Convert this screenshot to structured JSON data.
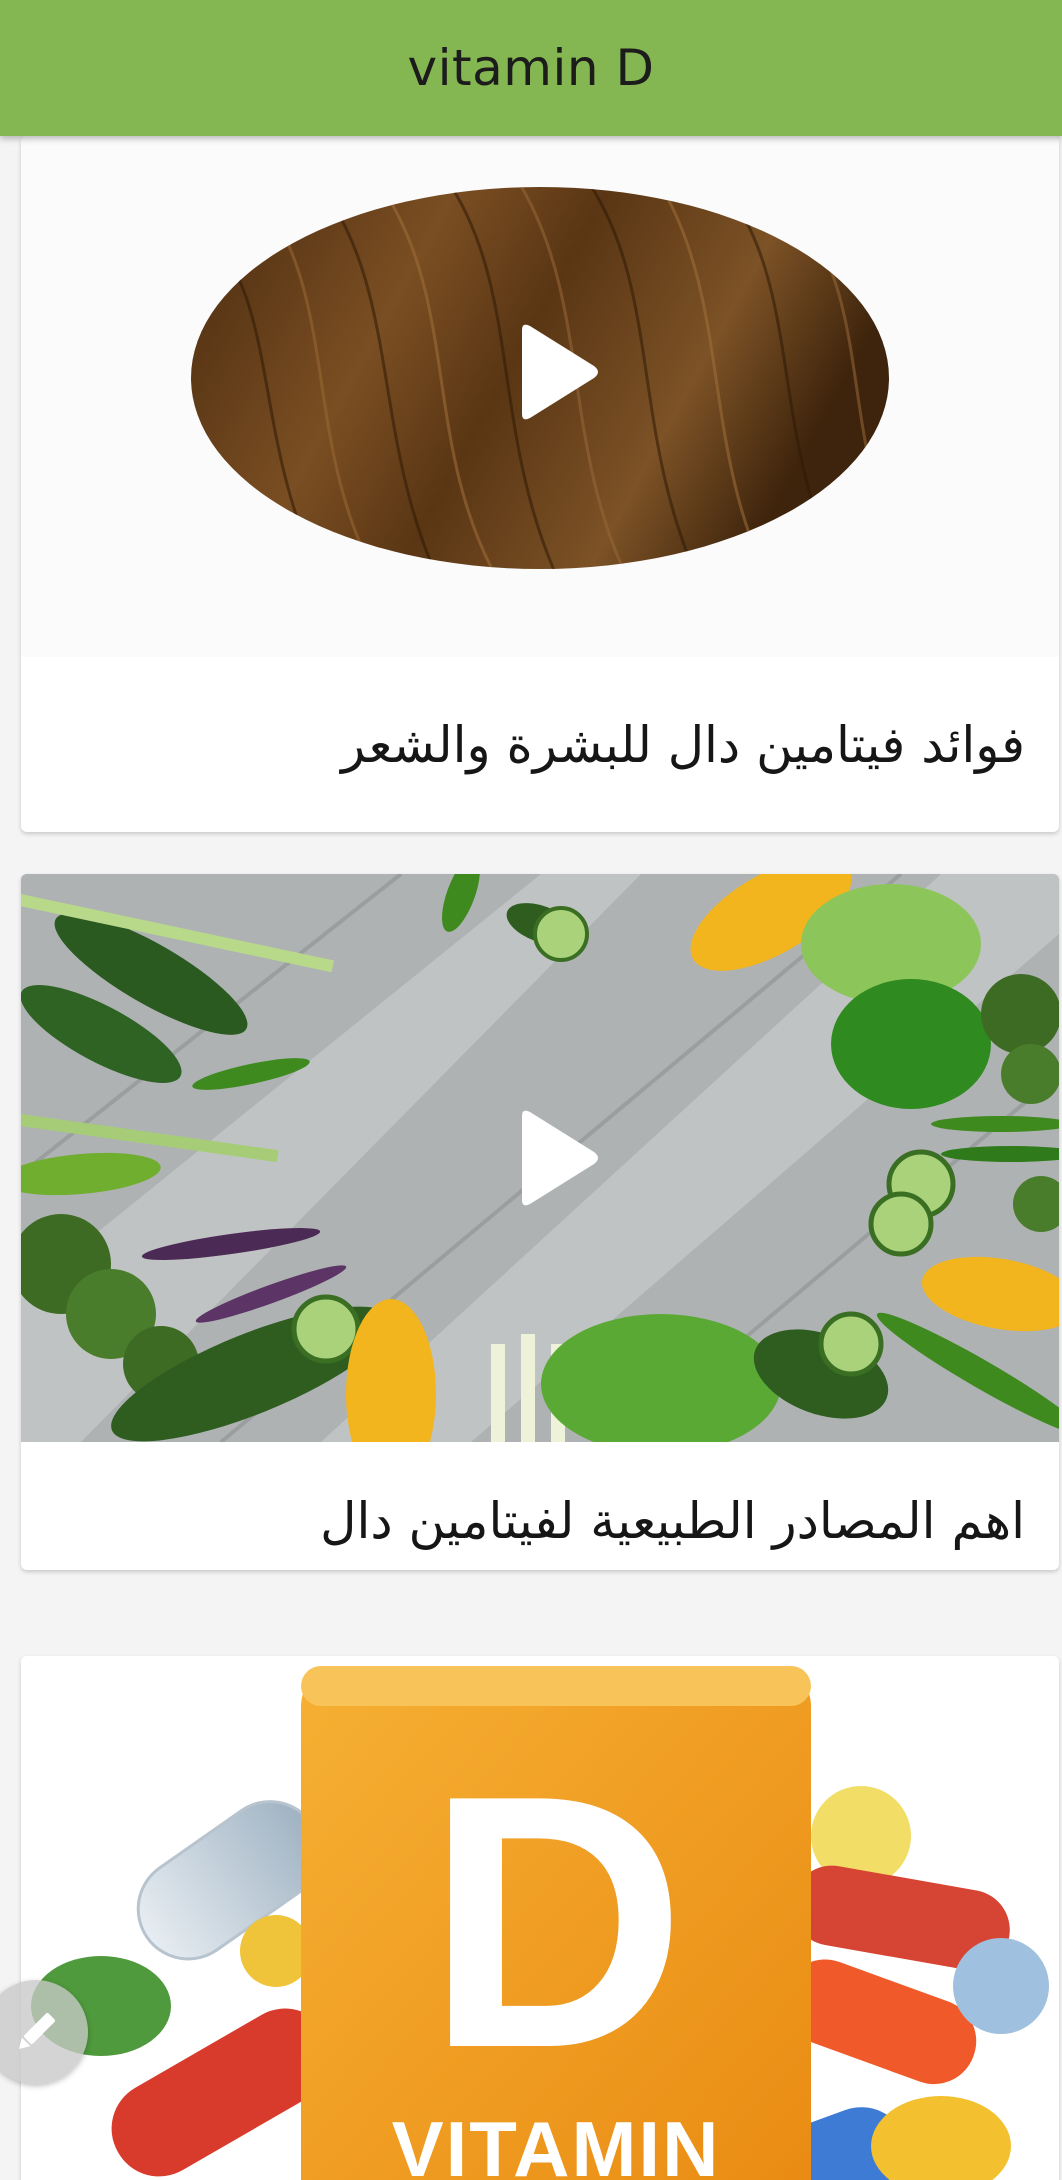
{
  "app_bar": {
    "title": "vitamin D",
    "background_color": "#84b651"
  },
  "feed": {
    "items": [
      {
        "title": "فوائد فيتامين دال للبشرة والشعر",
        "thumbnail": "brown-hair-oval-image",
        "has_play_button": true
      },
      {
        "title": "اهم المصادر الطبيعية لفيتامين دال",
        "thumbnail": "vegetables-on-wooden-table-image",
        "has_play_button": true
      },
      {
        "title": "",
        "thumbnail": "vitamin-d-cube-and-pills-image",
        "image_text": {
          "letter": "D",
          "word": "VITAMIN"
        },
        "has_play_button": false
      }
    ]
  },
  "fab": {
    "icon": "pencil-icon"
  }
}
